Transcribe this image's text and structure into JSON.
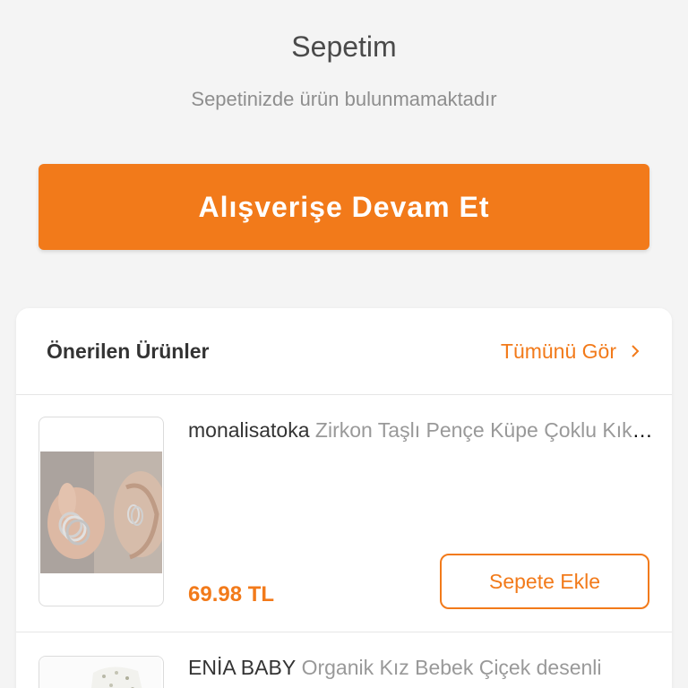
{
  "cart": {
    "title": "Sepetim",
    "empty_message": "Sepetinizde ürün bulunmamaktadır",
    "continue_label": "Alışverişe Devam Et"
  },
  "recommended": {
    "title": "Önerilen Ürünler",
    "see_all_label": "Tümünü Gör",
    "items": [
      {
        "brand": "monalisatoka",
        "description": "Zirkon Taşlı Pençe Küpe Çoklu Kıkırdak",
        "price": "69.98 TL",
        "add_label": "Sepete Ekle",
        "image_icon": "earring-photo"
      },
      {
        "brand": "ENİA BABY",
        "description": "Organik Kız Bebek Çiçek desenli",
        "image_icon": "baby-clothes-photo"
      }
    ]
  },
  "colors": {
    "accent": "#f27a1a",
    "background": "#f4f4f4"
  }
}
